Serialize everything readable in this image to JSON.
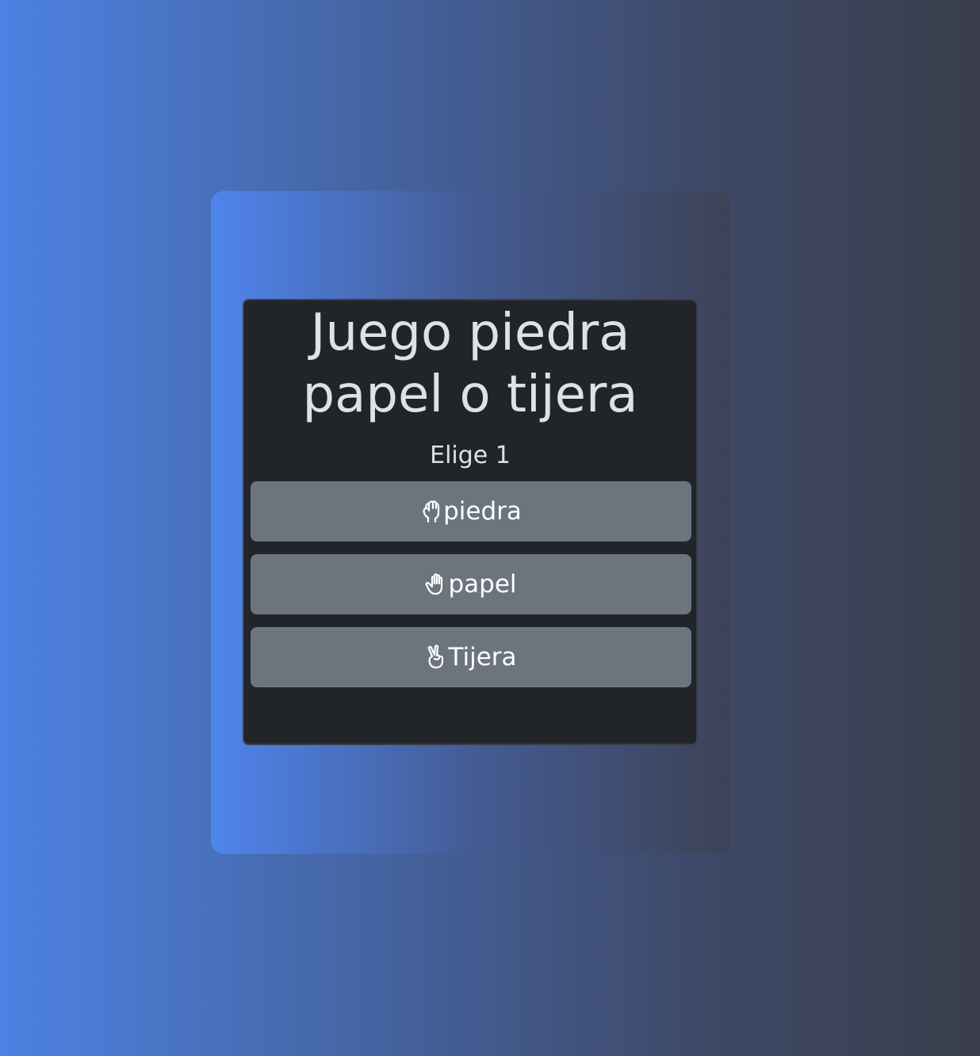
{
  "game": {
    "title_line1": "Juego piedra",
    "title_line2": "papel o tijera",
    "subtitle": "Elige 1",
    "options": [
      {
        "label": "piedra",
        "icon": "hand-rock-icon"
      },
      {
        "label": "papel",
        "icon": "hand-paper-icon"
      },
      {
        "label": "Tijera",
        "icon": "hand-scissors-icon"
      }
    ]
  },
  "colors": {
    "background_start": "#4d82e3",
    "background_end": "#3a3e4b",
    "card_background": "#212529",
    "button_background": "#6c757d",
    "text": "#dee2e6"
  }
}
